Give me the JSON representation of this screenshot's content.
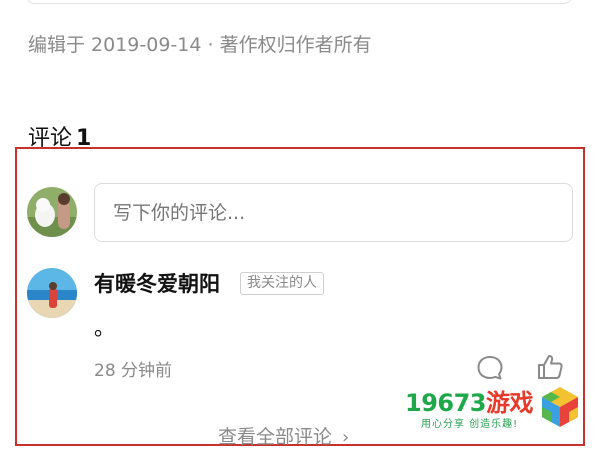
{
  "article": {
    "edit_info": "编辑于 2019-09-14 · 著作权归作者所有"
  },
  "comments_section": {
    "heading": "评论",
    "count": "1",
    "input_placeholder": "写下你的评论...",
    "view_all": "查看全部评论",
    "view_all_icon": "chevron-right-icon"
  },
  "comment": {
    "author": "有暖冬爱朝阳",
    "badge": "我关注的人",
    "text": "。",
    "time": "28 分钟前",
    "actions": [
      "reply-icon",
      "like-icon"
    ]
  },
  "watermark": {
    "number": "19673",
    "word": "游戏",
    "slogan": "用心分享 创造乐趣!"
  },
  "colors": {
    "highlight_border": "#c8302c",
    "secondary_text": "#8a8a8a",
    "watermark_green": "#1fa84a",
    "watermark_red": "#e83a2a"
  }
}
